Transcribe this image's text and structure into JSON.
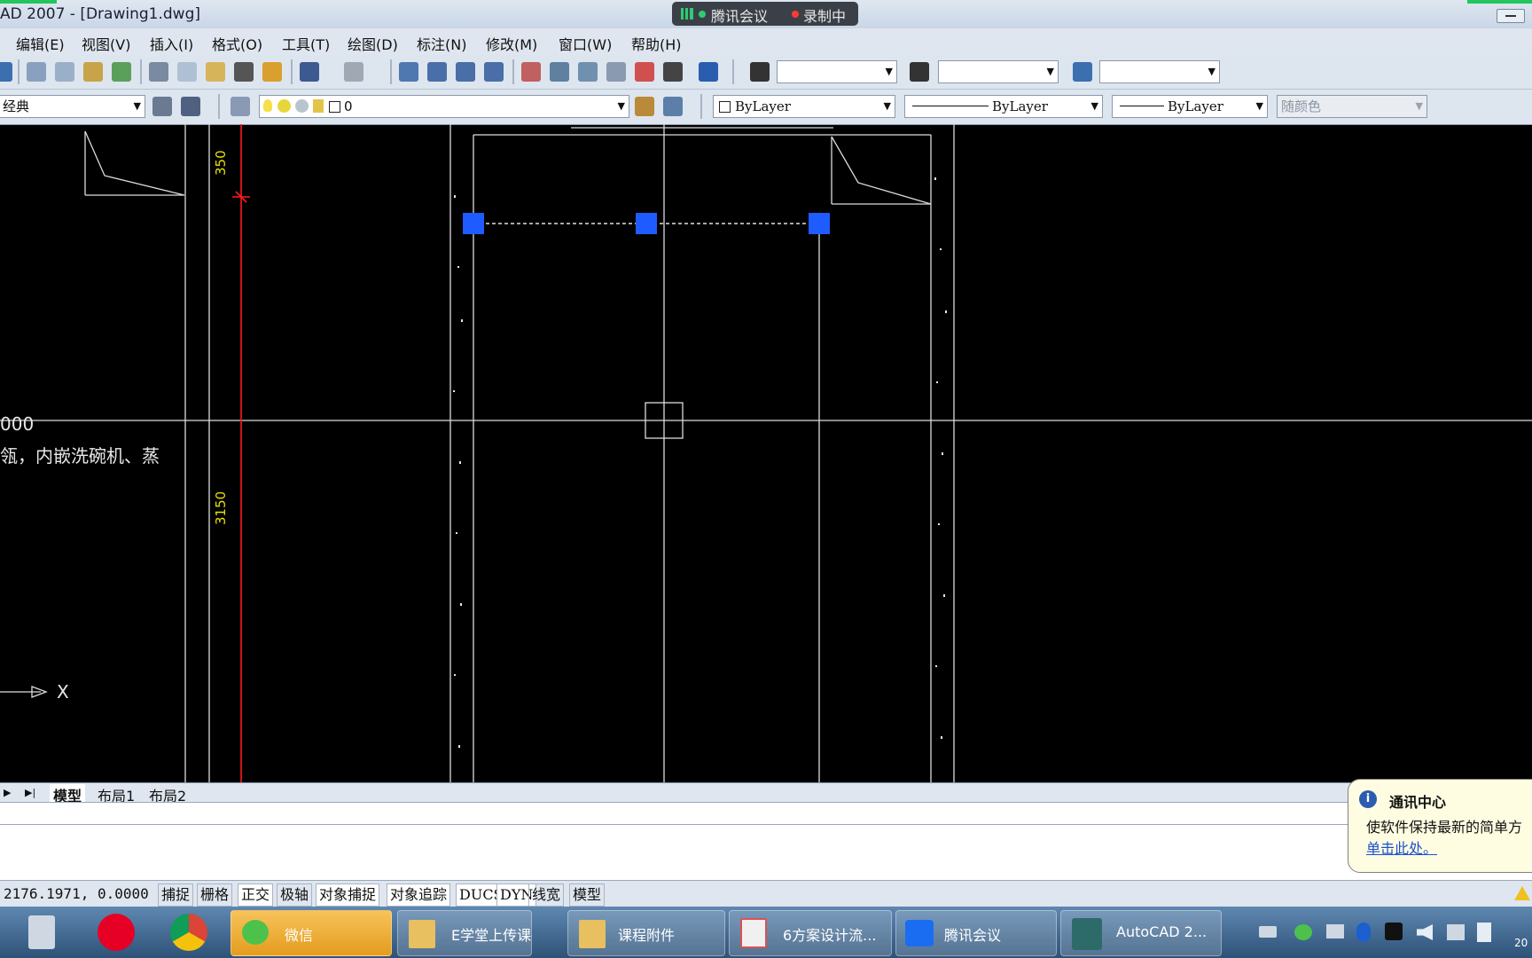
{
  "window": {
    "title": "AD 2007 - [Drawing1.dwg]",
    "meeting_app": "腾讯会议",
    "recording": "录制中"
  },
  "menu": [
    "编辑(E)",
    "视图(V)",
    "插入(I)",
    "格式(O)",
    "工具(T)",
    "绘图(D)",
    "标注(N)",
    "修改(M)",
    "窗口(W)",
    "帮助(H)"
  ],
  "toolbar": {
    "workspace": "经典",
    "layer": "0",
    "color": "ByLayer",
    "linetype": "ByLayer",
    "lineweight": "ByLayer",
    "plotstyle": "随颜色"
  },
  "drawing": {
    "dim_top": "350",
    "dim_mid": "3150",
    "text_line1": "000",
    "text_line2": "瓴，内嵌洗碗机、蒸",
    "axis_x": "X"
  },
  "tabs": [
    "模型",
    "布局1",
    "布局2"
  ],
  "status": {
    "coords": "2176.1971, 0.0000",
    "toggles": [
      "捕捉",
      "栅格",
      "正交",
      "极轴",
      "对象捕捉",
      "对象追踪",
      "DUCS",
      "DYN",
      "线宽",
      "模型"
    ]
  },
  "balloon": {
    "title": "通讯中心",
    "body": "使软件保持最新的简单方",
    "link": "单击此处。"
  },
  "taskbar": {
    "items": [
      "微信",
      "E学堂上传课...",
      "课程附件",
      "6方案设计流...",
      "腾讯会议",
      "AutoCAD 2..."
    ],
    "clock": "20"
  },
  "colors": {
    "canvas": "#000000",
    "grip": "#1e5cff",
    "dimension": "#e8e000",
    "red_line": "#ff1a1a"
  }
}
